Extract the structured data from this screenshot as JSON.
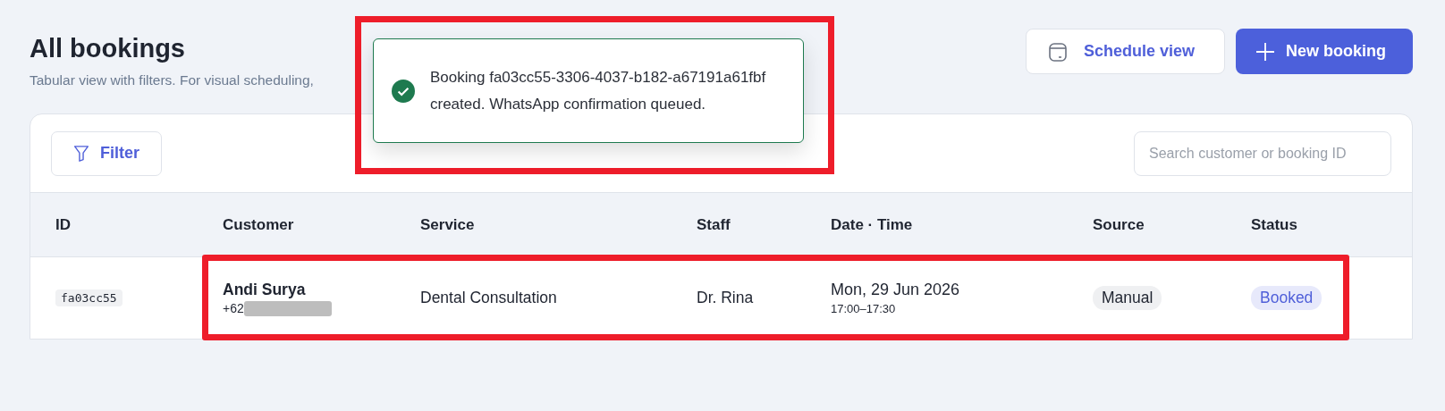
{
  "header": {
    "title": "All bookings",
    "subtitle": "Tabular view with filters. For visual scheduling,",
    "buttons": [
      {
        "label": "Schedule view",
        "kind": "secondary"
      },
      {
        "label": "New booking",
        "kind": "primary"
      }
    ]
  },
  "toast": {
    "message": "Booking fa03cc55-3306-4037-b182-a67191a61fbf created. WhatsApp confirmation queued.",
    "kind": "success",
    "highlighted": true
  },
  "toolbar": {
    "filter": "Filter",
    "search": {
      "placeholder": "Search customer or booking ID"
    }
  },
  "table": {
    "columns": [
      "ID",
      "Customer",
      "Service",
      "Staff",
      "Date · Time",
      "Source",
      "Status"
    ],
    "rows": [
      {
        "id": "fa03cc55",
        "customer": "Andi Surya",
        "phone": "+62",
        "phone_redacted": true,
        "service": "Dental Consultation",
        "staff": "Dr. Rina",
        "date": "Mon, 29 Jun 2026",
        "time": "17:00–17:30",
        "source": "Manual",
        "status": "Booked",
        "highlighted": true
      }
    ]
  }
}
